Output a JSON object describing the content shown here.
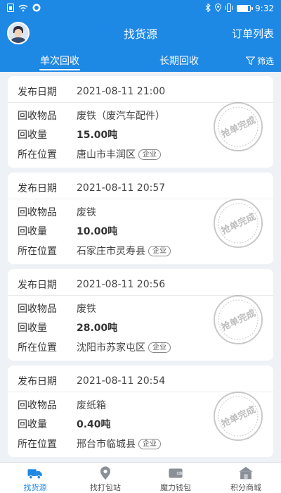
{
  "status_bar": {
    "network": "4G",
    "time": "9:32",
    "battery_level": 0.85
  },
  "header": {
    "title": "找货源",
    "right_action": "订单列表"
  },
  "tabs": [
    {
      "label": "单次回收",
      "active": true
    },
    {
      "label": "长期回收",
      "active": false
    }
  ],
  "filter_label": "筛选",
  "card_labels": {
    "date": "发布日期",
    "item": "回收物品",
    "amount": "回收量",
    "location": "所在位置"
  },
  "orders": [
    {
      "date": "2021-08-11 21:00",
      "item": "废铁（废汽车配件）",
      "amount": "15.00吨",
      "location": "唐山市丰润区",
      "badge": "企业",
      "stamp": "抢单完成"
    },
    {
      "date": "2021-08-11 20:57",
      "item": "废铁",
      "amount": "10.00吨",
      "location": "石家庄市灵寿县",
      "badge": "企业",
      "stamp": "抢单完成"
    },
    {
      "date": "2021-08-11 20:56",
      "item": "废铁",
      "amount": "28.00吨",
      "location": "沈阳市苏家屯区",
      "badge": "企业",
      "stamp": "抢单完成"
    },
    {
      "date": "2021-08-11 20:54",
      "item": "废纸箱",
      "amount": "0.40吨",
      "location": "邢台市临城县",
      "badge": "企业",
      "stamp": "抢单完成"
    }
  ],
  "bottom_nav": [
    {
      "label": "找货源",
      "icon": "truck-icon",
      "active": true
    },
    {
      "label": "找打包站",
      "icon": "location-icon",
      "active": false
    },
    {
      "label": "魔力钱包",
      "icon": "wallet-icon",
      "active": false
    },
    {
      "label": "积分商城",
      "icon": "store-icon",
      "active": false
    }
  ],
  "colors": {
    "primary": "#1e88e5",
    "background": "#eef1f6"
  }
}
